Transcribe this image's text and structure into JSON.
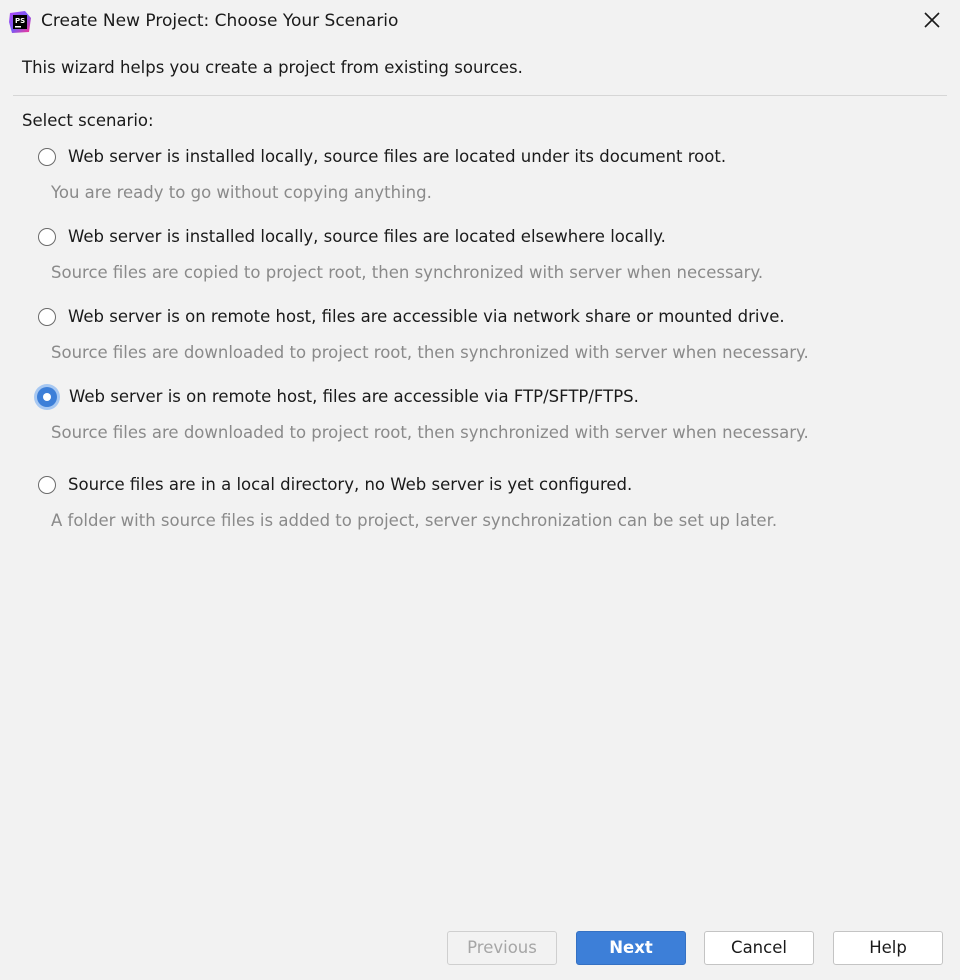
{
  "window": {
    "title": "Create New Project: Choose Your Scenario",
    "app_icon": "phpstorm-icon",
    "close_icon": "close-icon"
  },
  "intro": "This wizard helps you create a project from existing sources.",
  "select_label": "Select scenario:",
  "scenarios": [
    {
      "label": "Web server is installed locally, source files are located under its document root.",
      "description": "You are ready to go without copying anything.",
      "selected": false
    },
    {
      "label": "Web server is installed locally, source files are located elsewhere locally.",
      "description": "Source files are copied to project root, then synchronized with server when necessary.",
      "selected": false
    },
    {
      "label": "Web server is on remote host, files are accessible via network share or mounted drive.",
      "description": "Source files are downloaded to project root, then synchronized with server when necessary.",
      "selected": false
    },
    {
      "label": "Web server is on remote host, files are accessible via FTP/SFTP/FTPS.",
      "description": "Source files are downloaded to project root, then synchronized with server when necessary.",
      "selected": true
    },
    {
      "label": "Source files are in a local directory, no Web server is yet configured.",
      "description": "A folder with source files is added to project, server synchronization can be set up later.",
      "selected": false
    }
  ],
  "buttons": {
    "previous": "Previous",
    "next": "Next",
    "cancel": "Cancel",
    "help": "Help"
  },
  "colors": {
    "accent": "#3d7fd8",
    "background": "#f2f2f2",
    "description_text": "#8a8a8a"
  }
}
